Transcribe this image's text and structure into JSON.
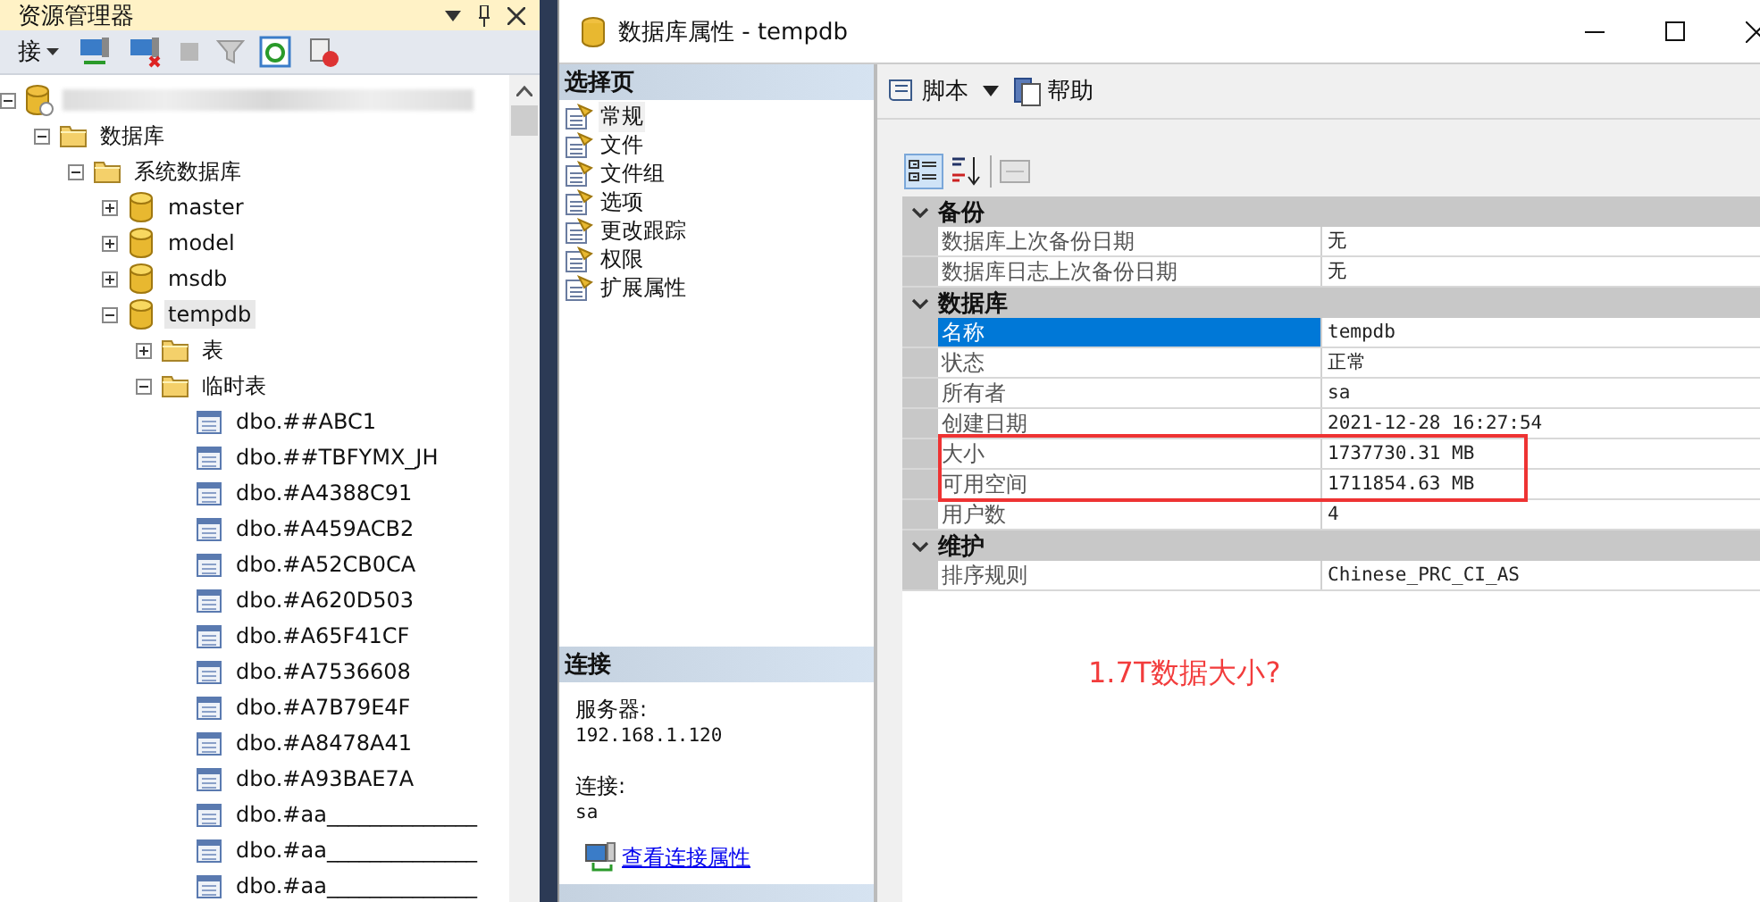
{
  "explorer": {
    "title": "资源管理器",
    "connect_label": "接",
    "tree": [
      {
        "kind": "server",
        "expanded": true,
        "children": [
          {
            "kind": "folder",
            "label": "数据库",
            "expanded": true,
            "selected": false,
            "children": [
              {
                "kind": "folder",
                "label": "系统数据库",
                "expanded": true,
                "selected": false,
                "children": [
                  {
                    "kind": "database",
                    "label": "master",
                    "expanded": false,
                    "selected": false
                  },
                  {
                    "kind": "database",
                    "label": "model",
                    "expanded": false,
                    "selected": false
                  },
                  {
                    "kind": "database",
                    "label": "msdb",
                    "expanded": false,
                    "selected": false
                  },
                  {
                    "kind": "database",
                    "label": "tempdb",
                    "expanded": true,
                    "selected": true,
                    "children": [
                      {
                        "kind": "folder",
                        "label": "表",
                        "expanded": false,
                        "selected": false
                      },
                      {
                        "kind": "folder",
                        "label": "临时表",
                        "expanded": true,
                        "selected": false,
                        "children": [
                          {
                            "kind": "table",
                            "label": "dbo.##ABC1",
                            "selected": false
                          },
                          {
                            "kind": "table",
                            "label": "dbo.##TBFYMX_JH",
                            "selected": false
                          },
                          {
                            "kind": "table",
                            "label": "dbo.#A4388C91",
                            "selected": false
                          },
                          {
                            "kind": "table",
                            "label": "dbo.#A459ACB2",
                            "selected": false
                          },
                          {
                            "kind": "table",
                            "label": "dbo.#A52CB0CA",
                            "selected": false
                          },
                          {
                            "kind": "table",
                            "label": "dbo.#A620D503",
                            "selected": false
                          },
                          {
                            "kind": "table",
                            "label": "dbo.#A65F41CF",
                            "selected": false
                          },
                          {
                            "kind": "table",
                            "label": "dbo.#A7536608",
                            "selected": false
                          },
                          {
                            "kind": "table",
                            "label": "dbo.#A7B79E4F",
                            "selected": false
                          },
                          {
                            "kind": "table",
                            "label": "dbo.#A8478A41",
                            "selected": false
                          },
                          {
                            "kind": "table",
                            "label": "dbo.#A93BAE7A",
                            "selected": false
                          },
                          {
                            "kind": "table",
                            "label": "dbo.#aa______________",
                            "selected": false
                          },
                          {
                            "kind": "table",
                            "label": "dbo.#aa______________",
                            "selected": false
                          },
                          {
                            "kind": "table",
                            "label": "dbo.#aa______________",
                            "selected": false
                          }
                        ]
                      }
                    ]
                  }
                ]
              }
            ]
          }
        ]
      }
    ]
  },
  "dialog": {
    "title": "数据库属性 - tempdb",
    "pages_header": "选择页",
    "pages": [
      {
        "label": "常规",
        "selected": true
      },
      {
        "label": "文件",
        "selected": false
      },
      {
        "label": "文件组",
        "selected": false
      },
      {
        "label": "选项",
        "selected": false
      },
      {
        "label": "更改跟踪",
        "selected": false
      },
      {
        "label": "权限",
        "selected": false
      },
      {
        "label": "扩展属性",
        "selected": false
      }
    ],
    "connection": {
      "header": "连接",
      "server_label": "服务器:",
      "server": "192.168.1.120",
      "conn_label": "连接:",
      "conn": "sa",
      "link": "查看连接属性"
    },
    "toolbar": {
      "script": "脚本",
      "help": "帮助"
    },
    "categories": [
      {
        "name": "备份",
        "expanded": true,
        "rows": [
          {
            "name": "数据库上次备份日期",
            "value": "无",
            "selected": false,
            "annotated": false
          },
          {
            "name": "数据库日志上次备份日期",
            "value": "无",
            "selected": false,
            "annotated": false
          }
        ]
      },
      {
        "name": "数据库",
        "expanded": true,
        "rows": [
          {
            "name": "名称",
            "value": "tempdb",
            "selected": true,
            "annotated": false
          },
          {
            "name": "状态",
            "value": "正常",
            "selected": false,
            "annotated": false
          },
          {
            "name": "所有者",
            "value": "sa",
            "selected": false,
            "annotated": false
          },
          {
            "name": "创建日期",
            "value": "2021-12-28 16:27:54",
            "selected": false,
            "annotated": false
          },
          {
            "name": "大小",
            "value": "1737730.31 MB",
            "selected": false,
            "annotated": true
          },
          {
            "name": "可用空间",
            "value": "1711854.63 MB",
            "selected": false,
            "annotated": true
          },
          {
            "name": "用户数",
            "value": "4",
            "selected": false,
            "annotated": false
          }
        ]
      },
      {
        "name": "维护",
        "expanded": true,
        "rows": [
          {
            "name": "排序规则",
            "value": "Chinese_PRC_CI_AS",
            "selected": false,
            "annotated": false
          }
        ]
      }
    ],
    "note": "1.7T数据大小?"
  }
}
